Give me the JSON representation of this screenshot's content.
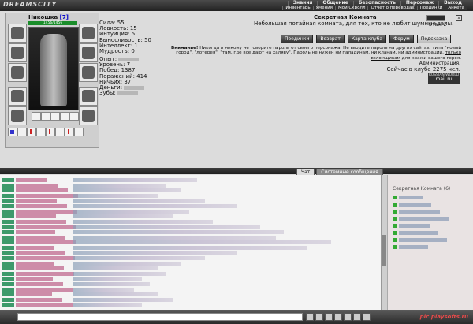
{
  "app": {
    "logo": "DREAMSCITY"
  },
  "menu": {
    "top": [
      "Знания",
      "Общение",
      "Безопасность",
      "Персонаж",
      "Выход"
    ],
    "sub": [
      "Инвентарь",
      "Умения",
      "Мой Скролл",
      "Отчет о переводах",
      "Поединки",
      "Анкета"
    ]
  },
  "character": {
    "name": "Никошка",
    "level": "[7]",
    "hp": "1456/1456",
    "stats": [
      "Сила: 55",
      "Ловкость: 15",
      "Интуиция: 5",
      "Выносливость: 50",
      "Интеллект: 1",
      "Мудрость: 0"
    ],
    "record": [
      "Опыт:",
      "Уровень: 7",
      "Побед: 1387",
      "Поражений: 414",
      "Ничьих: 37",
      "Деньги:",
      "Зубы:"
    ]
  },
  "room": {
    "title": "Секретная Комната",
    "description": "Небольшая потайная комната, для тех, кто не любит шумные залы.",
    "floor": "Этаж 2",
    "buttons": [
      "Поединки",
      "Возврат",
      "Карта клуба",
      "Форум",
      "Подсказка"
    ],
    "warning_bold": "Внимание!",
    "warning_text": "Никогда и никому не говорите пароль от своего персонажа. Не вводите пароль на других сайтах, типа \"новый город\", \"лотерея\", \"там, где все дают на халяву\". Пароль не нужен ни паладинам, ни кланам, ни администрации,",
    "warning_link": "только взломщикам",
    "warning_tail": "для кражи вашего героя.",
    "admin": "Администрация.",
    "online": "Сейчас в клубе 2275 чел.",
    "banner_top": "RUSSIAN WORLD",
    "banner_big": "mail.ru",
    "close": "x"
  },
  "chat": {
    "tabs": [
      "Чат",
      "Системные сообщения"
    ],
    "users_title": "Секретная Комната (6)",
    "watermark": "pic.playsofts.ru"
  }
}
